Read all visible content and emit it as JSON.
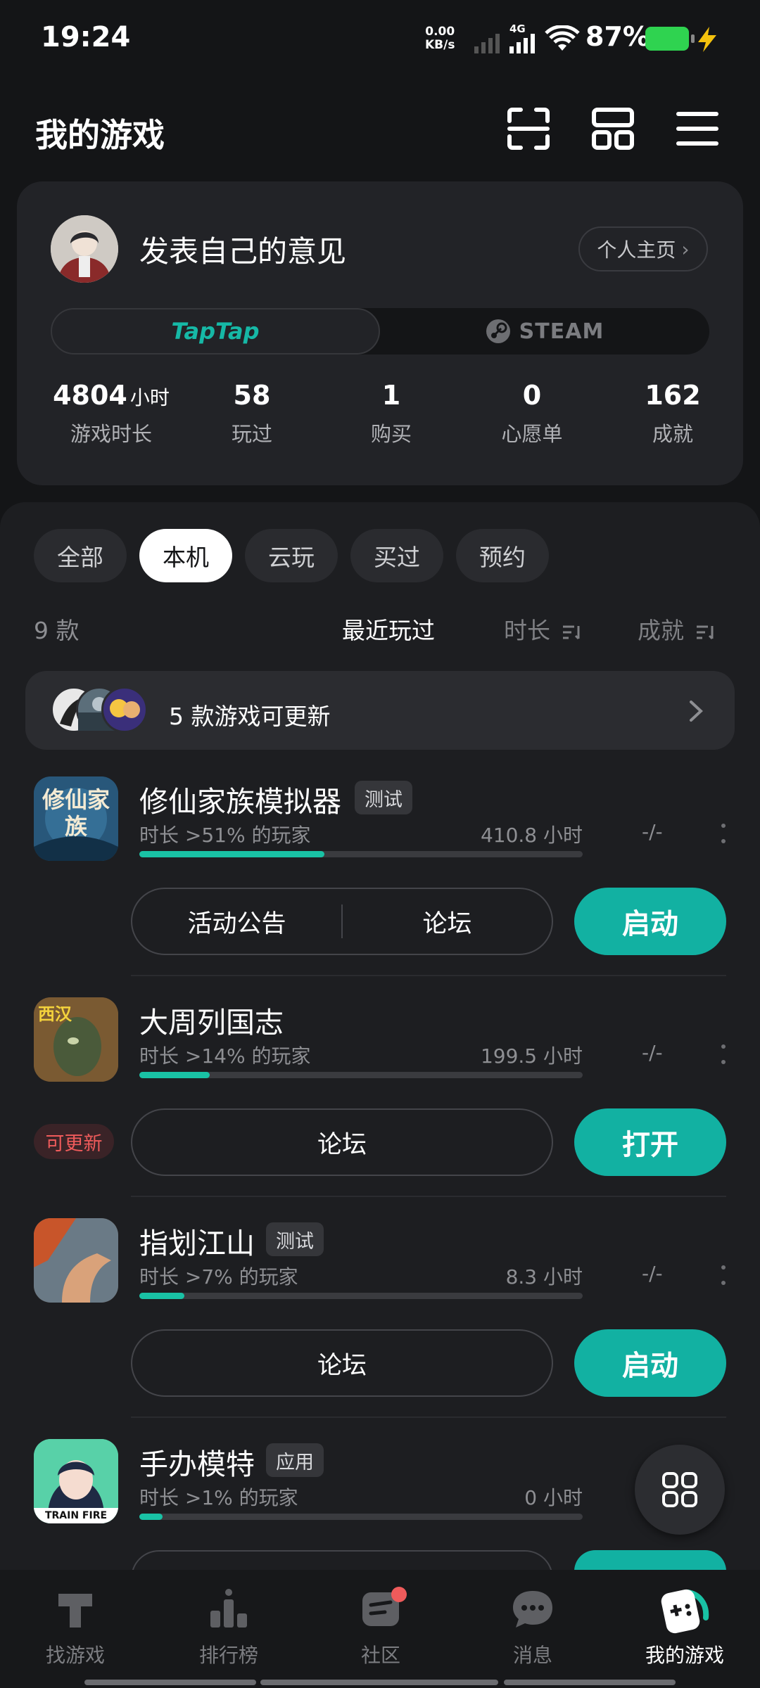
{
  "status_bar": {
    "time": "19:24",
    "net_speed_value": "0.00",
    "net_speed_unit": "KB/s",
    "network": "4G",
    "battery": "87%"
  },
  "header": {
    "title": "我的游戏",
    "icons": [
      "scan-icon",
      "layout-icon",
      "menu-icon"
    ]
  },
  "profile": {
    "username": "发表自己的意见",
    "homepage_label": "个人主页",
    "platforms": {
      "taptap": "TapTap",
      "steam": "STEAM"
    },
    "stats": [
      {
        "value": "4804",
        "unit": "小时",
        "label": "游戏时长"
      },
      {
        "value": "58",
        "label": "玩过"
      },
      {
        "value": "1",
        "label": "购买"
      },
      {
        "value": "0",
        "label": "心愿单"
      },
      {
        "value": "162",
        "label": "成就"
      }
    ]
  },
  "filters": [
    "全部",
    "本机",
    "云玩",
    "买过",
    "预约"
  ],
  "active_filter": "本机",
  "list": {
    "count": "9 款",
    "sort_recent": "最近玩过",
    "sort_duration": "时长",
    "sort_achievement": "成就",
    "update_banner": "5 款游戏可更新"
  },
  "games": [
    {
      "name": "修仙家族模拟器",
      "tag": "测试",
      "sub": "时长 >51% 的玩家",
      "hours": "410.8 小时",
      "achievement": "-/-",
      "progress": 0.51,
      "actions": [
        "活动公告",
        "论坛"
      ],
      "launch": "启动"
    },
    {
      "name": "大周列国志",
      "badge": "可更新",
      "sub": "时长 >14% 的玩家",
      "hours": "199.5 小时",
      "achievement": "-/-",
      "progress": 0.14,
      "actions": [
        "论坛"
      ],
      "launch": "打开"
    },
    {
      "name": "指划江山",
      "tag": "测试",
      "sub": "时长 >7% 的玩家",
      "hours": "8.3 小时",
      "achievement": "-/-",
      "progress": 0.07,
      "actions": [
        "论坛"
      ],
      "launch": "启动"
    },
    {
      "name": "手办模特",
      "tag": "应用",
      "sub": "时长 >1% 的玩家",
      "hours": "0 小时",
      "progress": 0.01,
      "icon_caption": "TRAIN FIRE"
    }
  ],
  "icon_texts": {
    "game1": "修仙家族",
    "game2": "西汉"
  },
  "bottom_nav": [
    {
      "label": "找游戏"
    },
    {
      "label": "排行榜"
    },
    {
      "label": "社区"
    },
    {
      "label": "消息"
    },
    {
      "label": "我的游戏"
    }
  ],
  "colors": {
    "accent": "#12b1a2",
    "progress": "#19c2a5",
    "update_red": "#ef5b5b",
    "background": "#141517"
  }
}
